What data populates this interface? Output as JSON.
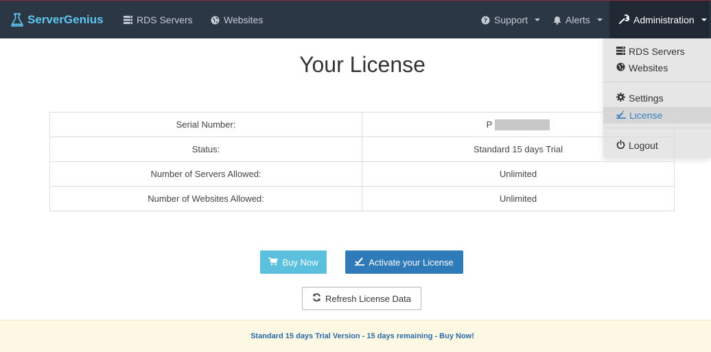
{
  "navbar": {
    "brand": "ServerGenius",
    "links": {
      "rds_servers": "RDS Servers",
      "websites": "Websites",
      "support": "Support",
      "alerts": "Alerts",
      "administration": "Administration"
    }
  },
  "dropdown": {
    "items": {
      "rds_servers": "RDS Servers",
      "websites": "Websites",
      "settings": "Settings",
      "license": "License",
      "logout": "Logout"
    }
  },
  "page": {
    "title": "Your License"
  },
  "license_table": {
    "rows": [
      {
        "label": "Serial Number:",
        "value": "P"
      },
      {
        "label": "Status:",
        "value": "Standard 15 days Trial"
      },
      {
        "label": "Number of Servers Allowed:",
        "value": "Unlimited"
      },
      {
        "label": "Number of Websites Allowed:",
        "value": "Unlimited"
      }
    ]
  },
  "buttons": {
    "buy_now": "Buy Now",
    "activate": "Activate your License",
    "refresh": "Refresh License Data"
  },
  "footer": {
    "message": "Standard 15 days Trial Version - 15 days remaining - Buy Now!"
  },
  "colors": {
    "navbar_bg": "#2c3746",
    "brand": "#5fc6ee",
    "info_button": "#5bc0de",
    "primary_button": "#2f7ab9",
    "footer_bg": "#fcf8e3",
    "footer_text": "#2b6aa6"
  }
}
